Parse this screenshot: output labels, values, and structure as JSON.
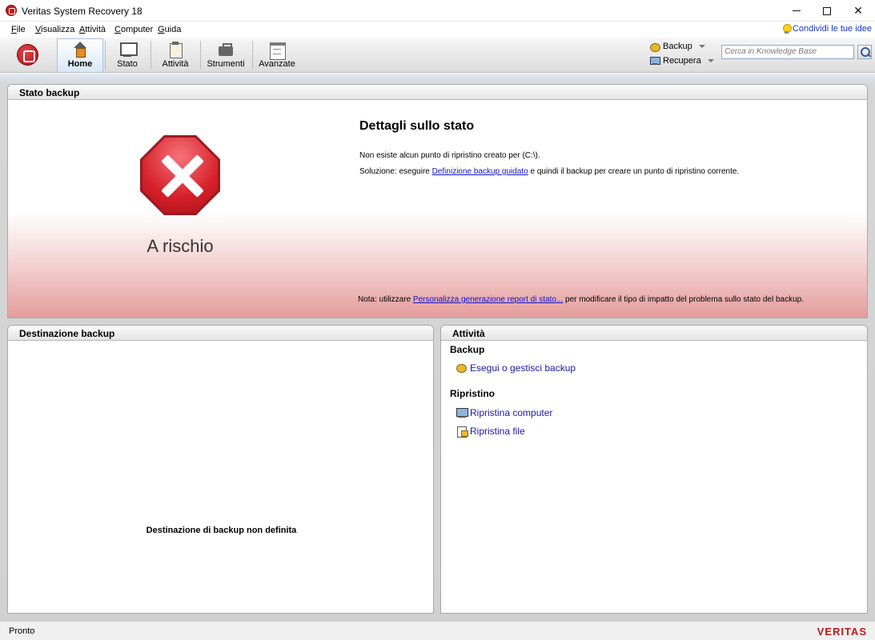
{
  "window": {
    "title": "Veritas System Recovery 18"
  },
  "menu": {
    "items": [
      "File",
      "Visualizza",
      "Attività",
      "Computer",
      "Guida"
    ],
    "idea_link": "Condividi le tue idee"
  },
  "toolbar": {
    "buttons": [
      {
        "label": "Home",
        "icon": "home-icon",
        "active": true
      },
      {
        "label": "Stato",
        "icon": "monitor-icon"
      },
      {
        "label": "Attività",
        "icon": "clipboard-icon"
      },
      {
        "label": "Strumenti",
        "icon": "toolbox-icon"
      },
      {
        "label": "Avanzate",
        "icon": "advanced-icon"
      }
    ],
    "backup_label": "Backup",
    "recupera_label": "Recupera",
    "search_placeholder": "Cerca in Knowledge Base"
  },
  "stato_backup": {
    "header": "Stato backup",
    "status_label": "A rischio",
    "details_title": "Dettagli sullo stato",
    "line1": "Non esiste alcun punto di ripristino creato per (C:\\).",
    "line2_prefix": "Soluzione: eseguire ",
    "line2_link": "Definizione backup guidato",
    "line2_suffix": " e quindi il backup per creare un punto di ripristino corrente.",
    "note_prefix": "Nota: utilizzare ",
    "note_link": "Personalizza generazione report di stato...",
    "note_suffix": " per modificare il tipo di impatto del problema sullo stato del backup."
  },
  "destinazione": {
    "header": "Destinazione backup",
    "message": "Destinazione di backup non definita"
  },
  "attivita": {
    "header": "Attività",
    "backup_section": "Backup",
    "backup_link": "Esegui o gestisci backup",
    "ripristino_section": "Ripristino",
    "ripristina_computer": "Ripristina computer",
    "ripristina_file": "Ripristina file"
  },
  "status": {
    "text": "Pronto",
    "brand": "VERITAS"
  },
  "colors": {
    "accent": "#c4161c",
    "link": "#1111cc"
  }
}
